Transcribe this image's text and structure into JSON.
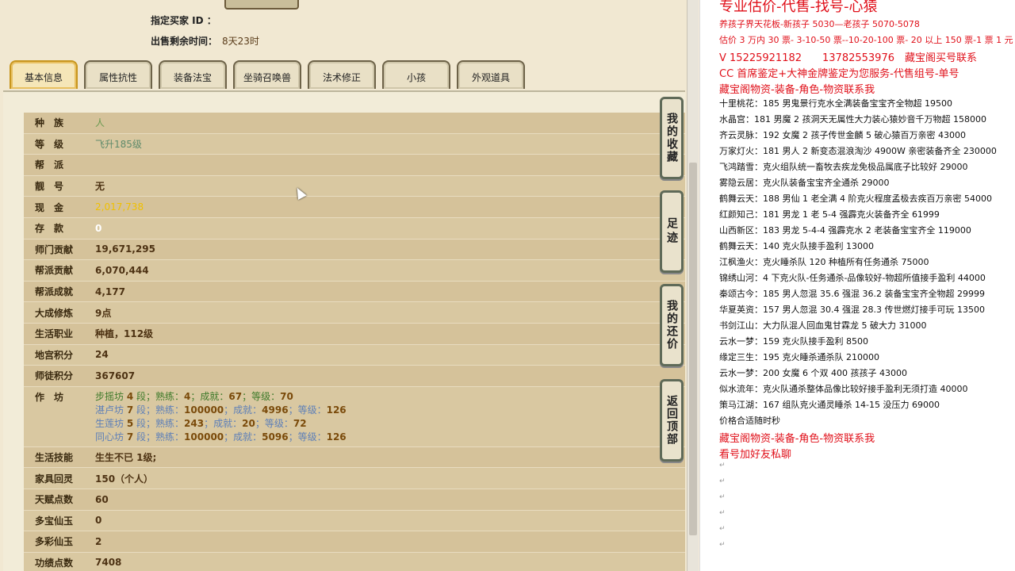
{
  "top": {
    "buyer_id_label": "指定买家 ID ：",
    "time_label": "出售剩余时间：",
    "time_value": "8天23时"
  },
  "tabs": [
    "基本信息",
    "属性抗性",
    "装备法宝",
    "坐骑召唤兽",
    "法术修正",
    "小孩",
    "外观道具"
  ],
  "active_tab": "基本信息",
  "rows": {
    "race": {
      "label": "种　族",
      "value": "人"
    },
    "level": {
      "label": "等　级",
      "value": "飞升185级"
    },
    "faction": {
      "label": "帮　派",
      "value": ""
    },
    "title": {
      "label": "靓　号",
      "value": "无"
    },
    "cash": {
      "label": "现　金",
      "value": "2,017,738"
    },
    "deposit": {
      "label": "存　款",
      "value": "0"
    },
    "school_contrib": {
      "label": "师门贡献",
      "value": "19,671,295"
    },
    "guild_contrib": {
      "label": "帮派贡献",
      "value": "6,070,444"
    },
    "guild_achieve": {
      "label": "帮派成就",
      "value": "4,177"
    },
    "dacheng": {
      "label": "大成修炼",
      "value": "9点"
    },
    "life_job": {
      "label": "生活职业",
      "value": "种植，112级"
    },
    "palace_points": {
      "label": "地宫积分",
      "value": "24"
    },
    "master_points": {
      "label": "师徒积分",
      "value": "367607"
    },
    "workshop": {
      "label": "作　坊",
      "lines": [
        {
          "name": "步摇坊",
          "seg": "4",
          "exp": "4",
          "achieve": "67",
          "lvl": "70"
        },
        {
          "name": "湛卢坊",
          "seg": "7",
          "exp": "100000",
          "achieve": "4996",
          "lvl": "126"
        },
        {
          "name": "生莲坊",
          "seg": "5",
          "exp": "243",
          "achieve": "20",
          "lvl": "72"
        },
        {
          "name": "同心坊",
          "seg": "7",
          "exp": "100000",
          "achieve": "5096",
          "lvl": "126"
        }
      ]
    },
    "life_skill": {
      "label": "生活技能",
      "value": "生生不已 1级;"
    },
    "furniture": {
      "label": "家具回灵",
      "value": "150（个人）"
    },
    "talent": {
      "label": "天赋点数",
      "value": "60"
    },
    "duobao": {
      "label": "多宝仙玉",
      "value": "0"
    },
    "duocai": {
      "label": "多彩仙玉",
      "value": "2"
    },
    "merit": {
      "label": "功绩点数",
      "value": "7408"
    }
  },
  "workshop_words": {
    "seg": "段；熟练：",
    "achieve": "；成就：",
    "lvl": "；等级："
  },
  "side_buttons": [
    "我的收藏",
    "足迹",
    "我的还价",
    "返回顶部"
  ],
  "right_panel": {
    "header": "专业估价-代售-找号-心猿",
    "lines": [
      {
        "text": "养孩子界天花板-新孩子 5030—老孩子 5070-5078",
        "red": true
      },
      {
        "text": "估价 3 万内 30 票- 3-10-50 票--10-20-100 票- 20 以上 150 票-1 票 1 元",
        "red": true
      },
      {
        "text": "V 15225921182　　13782553976　藏宝阁买号联系",
        "red": true,
        "mid": true
      },
      {
        "text": "CC 首席鉴定+大神金牌鉴定为您服务-代售组号-单号",
        "red": true,
        "mid": true
      },
      {
        "text": "藏宝阁物资-装备-角色-物资联系我",
        "red": true,
        "mid": true
      },
      {
        "text": "十里桃花：185 男鬼景行克水全满装备宝宝齐全物超 19500"
      },
      {
        "text": "水晶宫：181 男魔 2 孩洞天无属性大力装心猿妙音千万物超 158000"
      },
      {
        "text": "齐云灵脉：192 女魔 2 孩子传世金麟 5 破心猿百万亲密 43000"
      },
      {
        "text": "万家灯火：181 男人 2 新变态混浪淘沙 4900W 亲密装备齐全 230000"
      },
      {
        "text": "飞鸿踏雪：克火组队统一畜牧去疾龙免极品属底子比较好 29000"
      },
      {
        "text": "雾隐云居：克火队装备宝宝齐全通杀 29000"
      },
      {
        "text": "鹤舞云天：188 男仙 1 老全满 4 阶克火程度孟极去疾百万亲密 54000"
      },
      {
        "text": "红颜知己：181 男龙 1 老 5-4 强霹克火装备齐全 61999"
      },
      {
        "text": "山西新区：183 男龙 5-4-4 强霹克水 2 老装备宝宝齐全 119000"
      },
      {
        "text": "鹤舞云天：140 克火队接手盈利 13000"
      },
      {
        "text": "江枫渔火：克火睡杀队 120 种植所有任务通杀 75000"
      },
      {
        "text": "锦绣山河：4 下克火队-任务通杀-品像较好-物超所值接手盈利 44000"
      },
      {
        "text": "秦颂古今：185 男人忽混 35.6 强混 36.2 装备宝宝齐全物超 29999"
      },
      {
        "text": "华夏英资：157 男人忽混 30.4 强混 28.3 传世燃灯接手可玩 13500"
      },
      {
        "text": "书剑江山：大力队混人回血鬼甘霖龙 5 破大力 31000"
      },
      {
        "text": "云水一梦：159 克火队接手盈利 8500"
      },
      {
        "text": "缘定三生：195 克火睡杀通杀队 210000"
      },
      {
        "text": "云水一梦：200 女魔 6 个双 400 孩孩子 43000"
      },
      {
        "text": "似水流年：克火队通杀整体品像比较好接手盈利无须打造 40000"
      },
      {
        "text": "策马江湖：167 组队克火通灵睡杀 14-15 没压力 69000"
      },
      {
        "text": "价格合适随时秒"
      },
      {
        "text": "藏宝阁物资-装备-角色-物资联系我",
        "red": true,
        "mid": true
      },
      {
        "text": "看号加好友私聊",
        "red": true,
        "mid": true
      }
    ]
  },
  "colors": {
    "accent": "#e0101a",
    "gold": "#f0c000",
    "panel": "#d5c29a"
  }
}
